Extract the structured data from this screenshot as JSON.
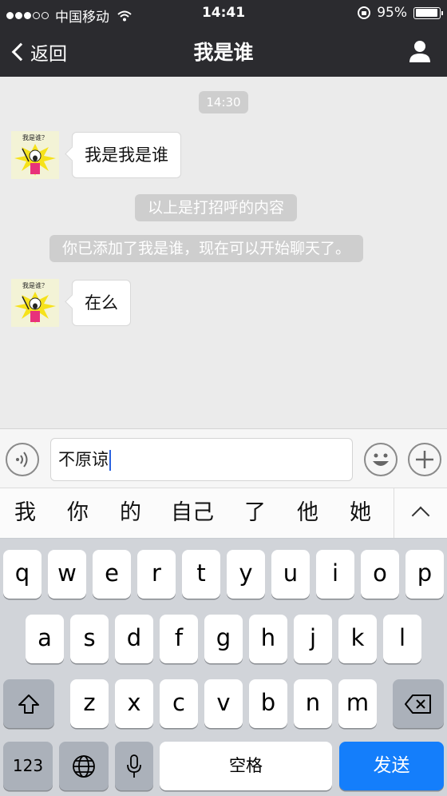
{
  "status_bar": {
    "carrier": "中国移动",
    "time": "14:41",
    "battery": "95%",
    "battery_level": 0.95,
    "signal_bars": 3
  },
  "nav": {
    "back_label": "返回",
    "title": "我是谁"
  },
  "chat": {
    "timestamp": "14:30",
    "messages": [
      {
        "text": "我是我是谁",
        "avatar_caption": "我是谁？"
      },
      {
        "text": "在么",
        "avatar_caption": "我是谁？"
      }
    ],
    "system_messages": [
      "以上是打招呼的内容",
      "你已添加了我是谁，现在可以开始聊天了。"
    ]
  },
  "input": {
    "value": "不原谅"
  },
  "candidates": [
    "我",
    "你",
    "的",
    "自己",
    "了",
    "他",
    "她"
  ],
  "keyboard": {
    "row1": [
      "q",
      "w",
      "e",
      "r",
      "t",
      "y",
      "u",
      "i",
      "o",
      "p"
    ],
    "row2": [
      "a",
      "s",
      "d",
      "f",
      "g",
      "h",
      "j",
      "k",
      "l"
    ],
    "row3": [
      "z",
      "x",
      "c",
      "v",
      "b",
      "n",
      "m"
    ],
    "num_label": "123",
    "space_label": "空格",
    "send_label": "发送"
  },
  "icons": {
    "back": "chevron-left-icon",
    "profile": "person-icon",
    "voice": "voice-icon",
    "emoji": "smiley-icon",
    "plus": "plus-icon",
    "shift": "shift-icon",
    "delete": "backspace-icon",
    "globe": "globe-icon",
    "mic": "microphone-icon",
    "collapse": "chevron-up-icon"
  },
  "colors": {
    "nav_bg": "#2b2b2f",
    "chat_bg": "#ebebeb",
    "send_key": "#147efb",
    "caret": "#2a62e0"
  }
}
